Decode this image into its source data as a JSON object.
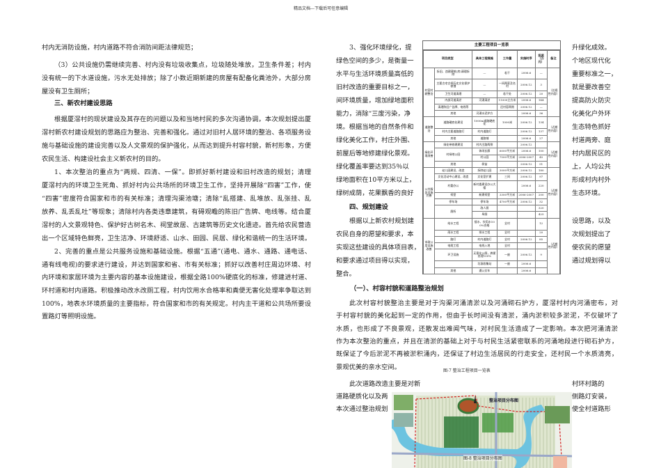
{
  "page_header": "精品文档---下载后可任意编辑",
  "left": {
    "lines": [
      {
        "t": "村内无消防设施，村内道路不符合消防间距法律规范；",
        "full": false,
        "indent": false
      },
      {
        "t": "（3）公共设施仍需继续完善、村内没有垃圾收集点，垃圾随处堆放，卫生条件差；村内",
        "full": true,
        "indent": true
      },
      {
        "t": "没有统一的下水道设施，污水无处排放；除了小数近期新建的房屋有配备化粪池外，大部分房",
        "full": true,
        "indent": false
      },
      {
        "t": "屋没有卫生厕所；",
        "full": false,
        "indent": false
      },
      {
        "t": "三、新农村建设思路",
        "full": false,
        "indent": true,
        "bold": true
      },
      {
        "t": "根据厦滘村的现状建设及其存在的问题以及和当地村民的多次沟通协调，本次规划提出厦",
        "full": true,
        "indent": true
      },
      {
        "t": "滘村新农村建设规划的思路应为整治、完善和强化。通过对旧村人居环境的整治、各项服务设",
        "full": true,
        "indent": false
      },
      {
        "t": "施与基础设施的建设完善以及人文景观的保护强化，从而达到提升村容村貌，新村形象，方便",
        "full": true,
        "indent": false
      },
      {
        "t": "农民生活、构建设社会主义新农村的目的。",
        "full": false,
        "indent": false
      },
      {
        "t": "1、本次整治的重点为“两规、四清、一保”。即抓好新村建设和旧村改造的规划；清理",
        "full": true,
        "indent": true
      },
      {
        "t": "厦滘村内的环境卫生死角、抓好村内公共场所的环境卫生工作，坚持开展除“四害”工作，使",
        "full": true,
        "indent": false
      },
      {
        "t": "“四害”密度符合国家和市的有关标准；清理沟渠池塘；清除“乱搭建、乱堆放、乱张挂、乱",
        "full": true,
        "indent": false
      },
      {
        "t": "放养、乱丢乱吐”等现象；清除村内各类违章建筑，有碍观瞻的陈旧广告牌、电线等。结合厦",
        "full": true,
        "indent": false
      },
      {
        "t": "滘村的人文景观特色、保护好古树名木、祠堂故居、古建筑等历史文化遗迹。首先给农民营造",
        "full": true,
        "indent": false
      },
      {
        "t": "出一个区域特色鲜亮，卫生洁净、环境舒适、山水、田园、民居、绿化和谐统一的生活环境。",
        "full": true,
        "indent": false
      },
      {
        "t": "2、完善的重点是公共服务设施和基础设施。根据“五通”(通电、通水、通路、通电话、",
        "full": true,
        "indent": true
      },
      {
        "t": "通有线电视)的要求进行建设，并达到国家和省、市有关标准；抓好以改善村庄周边环境、村",
        "full": true,
        "indent": false
      },
      {
        "t": "内环境和家居环境为主要内容的基本设施建设，根据全路100%硬底化的标准，修建进村道、",
        "full": true,
        "indent": false
      },
      {
        "t": "环村道和村内道路。积极推动改水改厕工程，村内饮用水合格率和粪便无害化处理率争取达到",
        "full": true,
        "indent": false
      },
      {
        "t": "100%，地表水环境质量的主要指标，符合国家和市的有关规定。村内主干道和公共场所要设",
        "full": true,
        "indent": false
      },
      {
        "t": "置路灯等照明设施。",
        "full": false,
        "indent": false
      }
    ]
  },
  "mid": {
    "lines": [
      {
        "t": "3、强化环境绿化，提",
        "indent": true
      },
      {
        "t": "绿色空间的多少，是衡量一"
      },
      {
        "t": "水平与生活环境质量高低的"
      },
      {
        "t": "旧村改造的重要目标之一，"
      },
      {
        "t": "间环境质量，增加绿地面积"
      },
      {
        "t": "能力，消除“三废污染，净"
      },
      {
        "t": "境。根据当地的自然条件和"
      },
      {
        "t": "绿化美化工作，村庄外围、"
      },
      {
        "t": "前屋后等地修建绿化景观。"
      },
      {
        "t": "绿化覆盖率要达到35％以"
      },
      {
        "t": "绿地面积在10平方米以上，"
      },
      {
        "t": "绿树成荫，花果飘香的良好"
      },
      {
        "t": "四、规划建设",
        "indent": true,
        "bold": true
      },
      {
        "t": "根据以上新农村规划建",
        "indent": true
      },
      {
        "t": "农民自身的愿望和要求，本"
      },
      {
        "t": "实现这些建设的具体项目表，"
      },
      {
        "t": "和要求通过项目得以实现，"
      },
      {
        "t": "整合。"
      }
    ]
  },
  "right": {
    "lines": [
      "升绿化成效。",
      "个地区现代化",
      "重要标准之一，",
      "就是要改善空",
      "提高防火防灾",
      "化美化户外环",
      "生态特色抓好",
      "村道两旁、庭",
      "村内居民区的",
      "上，人均公共",
      "形成村内村外",
      "生态环境。",
      "",
      "设思路，以及",
      "次规划提出了",
      "使农民的愿望",
      "通过规划得以"
    ]
  },
  "section_1_title": "（一）、村容村貌和道路整治规划",
  "section_1": {
    "lines": [
      {
        "t": "此次村容村貌整治主要是对于沟渠河涌清淤以及河涌砌石护方，厦滘村村内河涌密布，对",
        "full": true,
        "indent": true
      },
      {
        "t": "于村容村貌的美化起到一定的作用，但由于长时间没有清淤，涌内淤积较多淤泥，不仅破坏了",
        "full": true
      },
      {
        "t": "水质，也形成了不良景观，还散发出难闻气味，对村民生活造成了一定影响。本次把河涌清淤",
        "full": true
      },
      {
        "t": "作为本次整治的重点，并且在清淤的基础上对于与村民生活紧密联系的河涌地段进行砌石护方，",
        "full": true
      },
      {
        "t": "既保证了今后淤泥不再被淤积涌内，还保证了村边生活居民的行走安全，还村民一个水质清亮，",
        "full": true
      },
      {
        "t": "景观优美的亲水空间。",
        "full": false
      }
    ]
  },
  "road": {
    "left_lines": [
      "此次道路改造主要是对新",
      "道路硬质化以及两",
      "本次通过整治规划"
    ],
    "right_lines": [
      "村环村路的",
      "侧路灯安装，",
      "使全村道路形"
    ]
  },
  "figure7_caption": "图-7 整治工程项目一览表",
  "figure8_caption": "图-8 整治项目分布图",
  "map_title": "整治项目分布图",
  "table": {
    "title": "主要工程项目一览表",
    "headers": [
      "项目类型",
      "具体工程措施",
      "工作量",
      "实施时序",
      "投资（万元）",
      "备注"
    ],
    "groups": [
      {
        "type": "村容村貌整治",
        "remark": "（总规性内容）",
        "rows": [
          [
            "拆旧、违建建筑(房)清理拆除",
            "—",
            "若干",
            "2006.6",
            "—"
          ],
          [
            "主要古宅古祠历史文化保护修缮",
            "—",
            "一间两家及名村",
            "2006.12",
            "3"
          ],
          [
            "卫生河道清理",
            "—",
            "若干处",
            "2006.12",
            "20"
          ],
          [
            "内部河道清淤",
            "河涌清淤",
            "11000立方米",
            "2006.6",
            "144"
          ],
          [
            "清理陈旧广告牌、电线等",
            "",
            "还村容两侧",
            "2006.12",
            "—"
          ],
          [
            "其他",
            "河涌水泥护方",
            "",
            "2006.6",
            "36"
          ]
        ]
      },
      {
        "type": "道路整治",
        "remark": "（近期性内容）",
        "rows": [
          [
            "道路硬底化建设",
            "1000m道路硬底化",
            "1000米",
            "2006.12",
            "134"
          ],
          [
            "村内主要道路路灯",
            "村内道路灯",
            "",
            "2006.12",
            "137"
          ],
          [
            "其他",
            "道路铺",
            "",
            "2006.6",
            "27"
          ]
        ]
      },
      {
        "type": "绿化环境改善",
        "remark": "（近期性内容）",
        "rows": [
          [
            "绿化带修建建设",
            "村内主路两侧",
            "",
            "2006.12",
            ""
          ],
          [
            "村绿地公园",
            "休闲长廊",
            "6000平方米",
            "2006.6",
            "100"
          ],
          [
            null,
            "村公园",
            "7500平方米",
            "2006-2007",
            "45"
          ],
          [
            "其他",
            "树苗",
            "",
            "2006.12",
            "51"
          ]
        ]
      },
      {
        "type": "公共服务设施完善",
        "remark": "（近期性内容）",
        "rows": [
          [
            "幼儿园建设、改造",
            "拆除幼儿园",
            "3000平方米",
            "2006.12",
            "180"
          ],
          [
            "文化活动中心建设、改造",
            "文化室扩建",
            "三间",
            "2006.12",
            "97"
          ],
          [
            "村委办公",
            "新村委建设办公大楼",
            "",
            "2006.6",
            "220"
          ],
          [
            "祠堂",
            "新建祠堂",
            "3300平方米",
            "2006-2007",
            "200"
          ],
          [
            "停车场",
            "停车场",
            "4700平方米",
            "2006.12",
            "32"
          ],
          [
            "厕所",
            "改人厕",
            "",
            "",
            "320"
          ],
          [
            null,
            "旱厕",
            "",
            "",
            "425"
          ]
        ]
      },
      {
        "type": "市政公用设施改善",
        "remark": "（近期性内容）",
        "rows": [
          [
            "给水工程",
            "接水、饮用水100%合格",
            "全村",
            "",
            "12"
          ],
          [
            "雨水工程",
            "排水工程",
            "全村",
            "",
            "20"
          ],
          [
            "路灯",
            "村内道路灯",
            "全村",
            "2006.12",
            "85"
          ],
          [
            "电缆工程",
            "电线入地",
            "全村",
            "",
            ""
          ],
          [
            "环卫设施",
            "无害化公厕，粪便处理100%",
            "一座",
            "2006.12",
            "9"
          ],
          [
            "",
            "垃圾收集站",
            "一座",
            "2006.6",
            ""
          ],
          [
            "其他",
            "通公交车",
            "",
            "2006.6",
            ""
          ]
        ]
      }
    ]
  },
  "colors": {
    "river": "#6cc3e0",
    "boundary": "#d42020",
    "green": "#2f7a3a",
    "houses": "#dfe6cf"
  }
}
